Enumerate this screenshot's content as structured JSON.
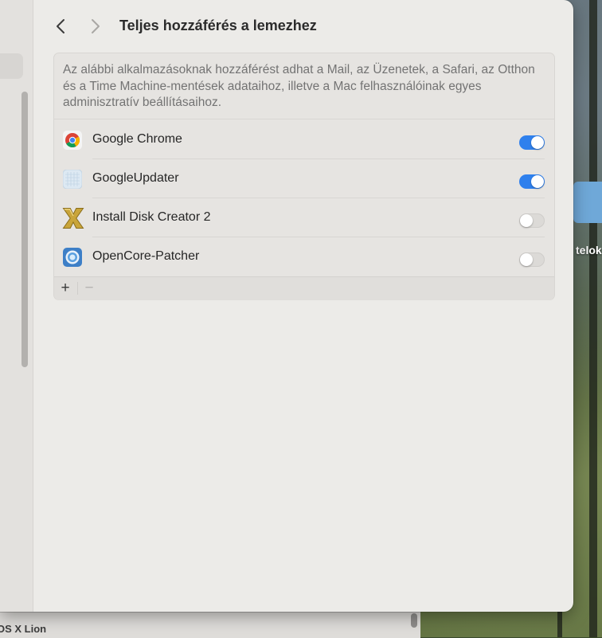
{
  "window": {
    "title": "Teljes hozzáférés a lemezhez",
    "description": "Az alábbi alkalmazásoknak hozzáférést adhat a Mail, az Üzenetek, a Safari, az Otthon és a Time Machine-mentések adataihoz, illetve a Mac felhasználóinak egyes adminisztratív beállításaihoz.",
    "apps": [
      {
        "name": "Google Chrome",
        "icon": "chrome-icon",
        "enabled": true
      },
      {
        "name": "GoogleUpdater",
        "icon": "googleupdater-icon",
        "enabled": true
      },
      {
        "name": "Install Disk Creator 2",
        "icon": "install-disk-creator-icon",
        "enabled": false
      },
      {
        "name": "OpenCore-Patcher",
        "icon": "opencore-patcher-icon",
        "enabled": false
      }
    ],
    "footer": {
      "add_label": "+",
      "remove_label": "−"
    }
  },
  "background": {
    "window_label": "OS X Lion",
    "desktop_item_label": "telok"
  },
  "colors": {
    "accent": "#2f80ed",
    "window_bg": "#ecebe8"
  }
}
